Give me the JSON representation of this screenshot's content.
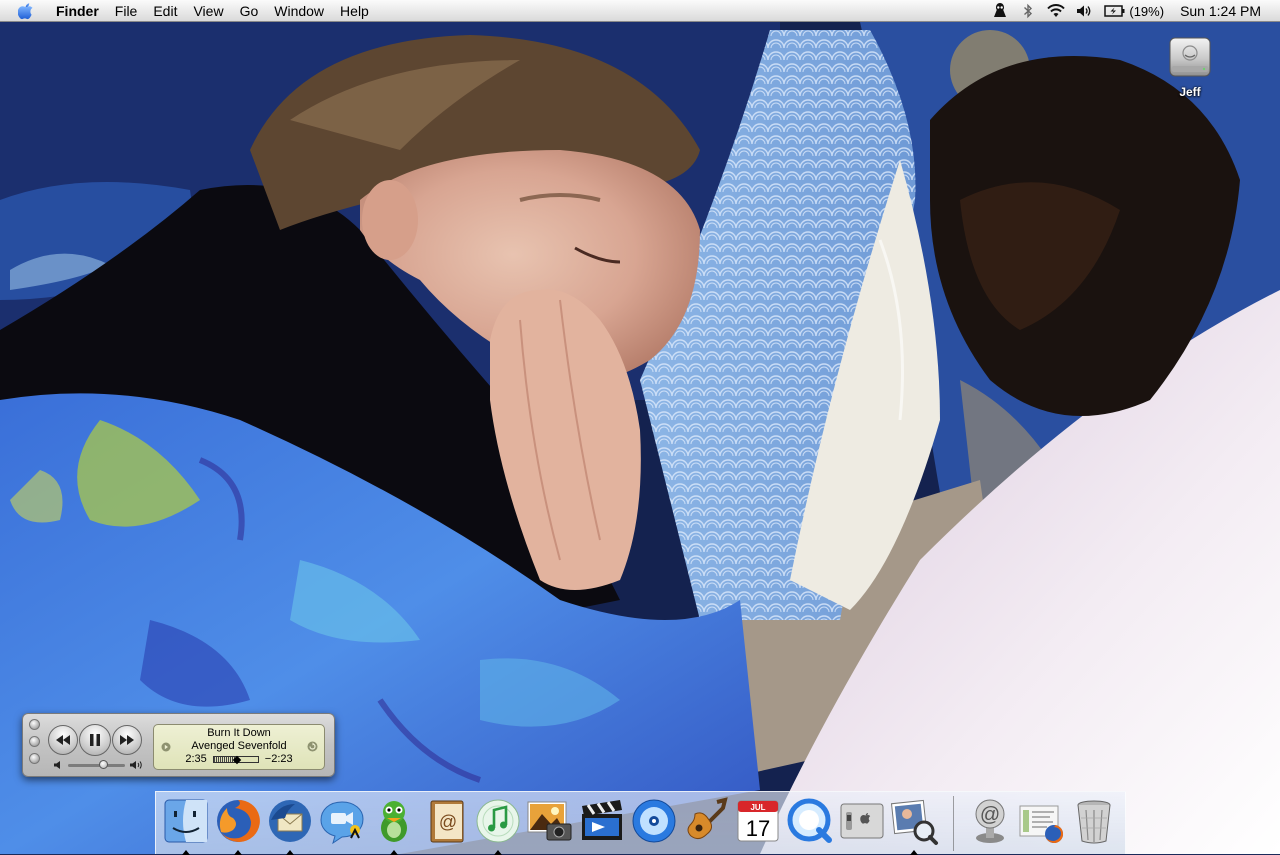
{
  "menubar": {
    "app_name": "Finder",
    "menus": [
      "File",
      "Edit",
      "View",
      "Go",
      "Window",
      "Help"
    ],
    "battery_text": "(19%)",
    "clock": "Sun 1:24 PM",
    "status_icons": [
      "spy-icon",
      "bluetooth-icon",
      "wifi-icon",
      "volume-icon",
      "battery-icon"
    ]
  },
  "desktop": {
    "icons": [
      {
        "label": "Jeff",
        "icon": "hard-drive-icon"
      }
    ]
  },
  "itunes": {
    "song": "Burn It Down",
    "artist": "Avenged Sevenfold",
    "elapsed": "2:35",
    "remaining": "−2:23",
    "progress_fraction": 0.52,
    "volume_fraction": 0.62
  },
  "dock": {
    "apps": [
      {
        "name": "finder-icon",
        "running": true
      },
      {
        "name": "firefox-icon",
        "running": true
      },
      {
        "name": "thunderbird-icon",
        "running": true
      },
      {
        "name": "ichat-icon",
        "running": false
      },
      {
        "name": "adium-icon",
        "running": true
      },
      {
        "name": "address-book-icon",
        "running": false
      },
      {
        "name": "itunes-icon",
        "running": true
      },
      {
        "name": "iphoto-icon",
        "running": false
      },
      {
        "name": "imovie-icon",
        "running": false
      },
      {
        "name": "idvd-icon",
        "running": false
      },
      {
        "name": "garageband-icon",
        "running": false
      },
      {
        "name": "ical-icon",
        "running": false
      },
      {
        "name": "quicktime-icon",
        "running": false
      },
      {
        "name": "system-preferences-icon",
        "running": false
      },
      {
        "name": "preview-icon",
        "running": true
      }
    ],
    "docs": [
      {
        "name": "mail-server-icon"
      },
      {
        "name": "firefox-downloads-icon"
      },
      {
        "name": "trash-icon"
      }
    ],
    "ical_month": "JUL",
    "ical_day": "17"
  }
}
